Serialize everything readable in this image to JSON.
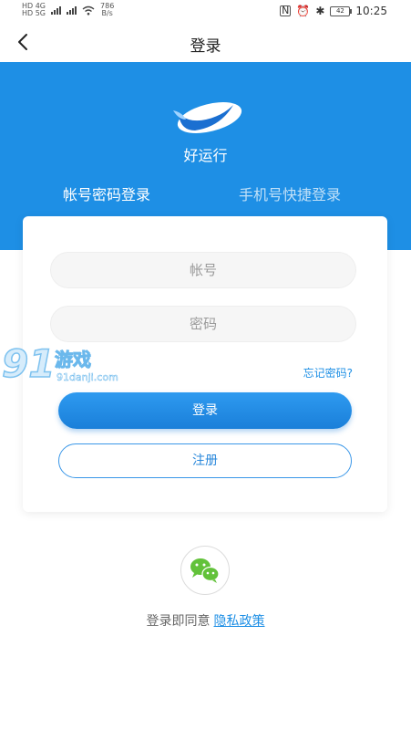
{
  "status_bar": {
    "network_left_top": "HD 4G",
    "network_left_bottom": "HD 5G",
    "speed": "786",
    "speed_unit": "B/s",
    "battery": "42",
    "time": "10:25"
  },
  "nav": {
    "title": "登录",
    "back_icon": "chevron-left-icon"
  },
  "hero": {
    "app_name": "好运行",
    "tabs": [
      {
        "label": "帐号密码登录",
        "active": true
      },
      {
        "label": "手机号快捷登录",
        "active": false
      }
    ]
  },
  "form": {
    "account_placeholder": "帐号",
    "password_placeholder": "密码",
    "forgot_label": "忘记密码?",
    "login_label": "登录",
    "register_label": "注册"
  },
  "watermark": {
    "brand": "91游戏",
    "site": "91danji.com"
  },
  "footer": {
    "wechat_icon": "wechat-icon",
    "agree_text": "登录即同意",
    "privacy_label": "隐私政策"
  },
  "colors": {
    "primary": "#1e8fe5",
    "wechat": "#62c23a"
  }
}
